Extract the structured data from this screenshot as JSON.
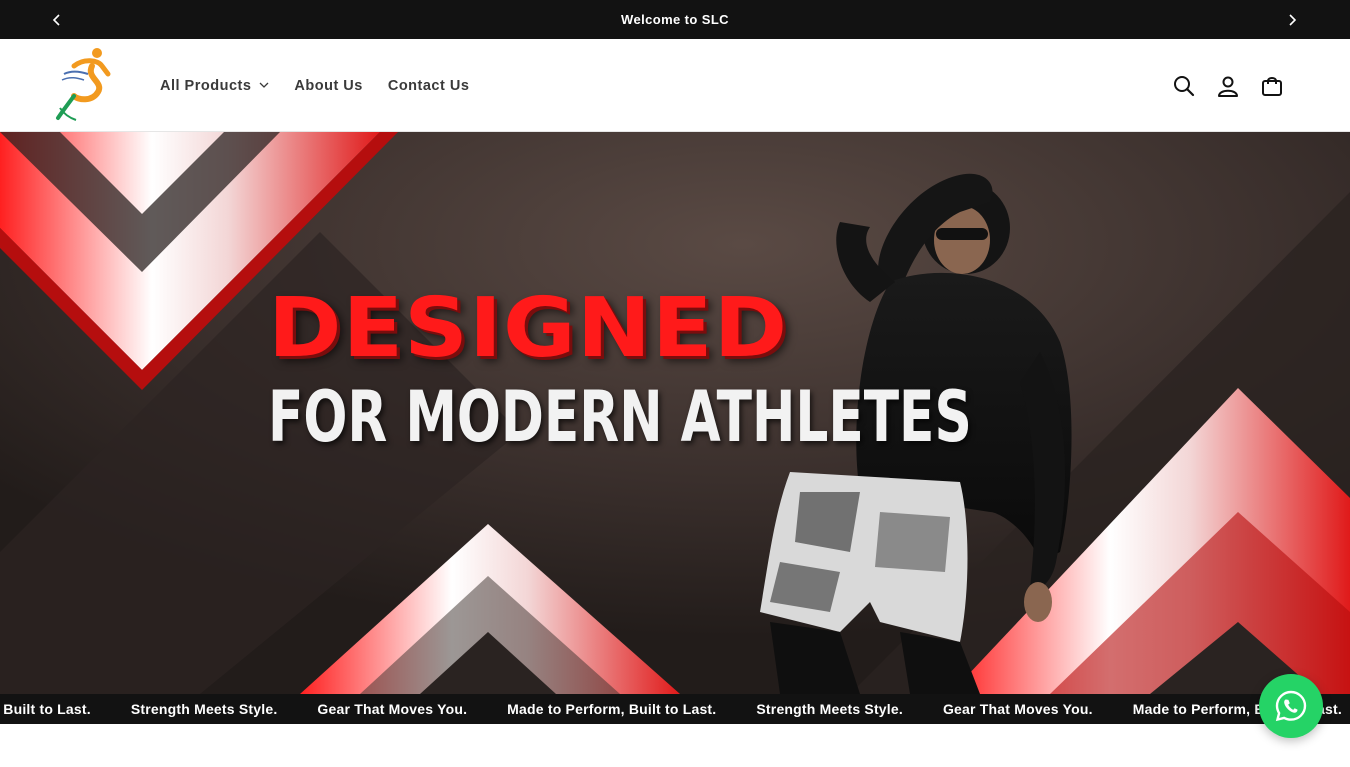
{
  "announcement": {
    "message": "Welcome to SLC",
    "prev_icon": "chevron-left-icon",
    "next_icon": "chevron-right-icon"
  },
  "header": {
    "logo": "slc-runner-logo",
    "nav": [
      {
        "label": "All Products",
        "has_dropdown": true
      },
      {
        "label": "About Us",
        "has_dropdown": false
      },
      {
        "label": "Contact Us",
        "has_dropdown": false
      }
    ],
    "icons": [
      "search-icon",
      "account-icon",
      "cart-icon"
    ]
  },
  "hero": {
    "headline": "DESIGNED",
    "subheadline": "FOR MODERN ATHLETES",
    "colors": {
      "accent": "#ff1a1a",
      "background": "#3a2f2c",
      "text": "#f2f2f2"
    }
  },
  "marquee": {
    "items": [
      "Perform, Built to Last.",
      "Strength Meets Style.",
      "Gear That Moves You.",
      "Made to Perform, Built to Last.",
      "Strength Meets Style.",
      "Gear That Moves You.",
      "Made to Perform, Built to Last."
    ]
  },
  "whatsapp": {
    "icon": "whatsapp-icon",
    "color": "#25d366"
  }
}
